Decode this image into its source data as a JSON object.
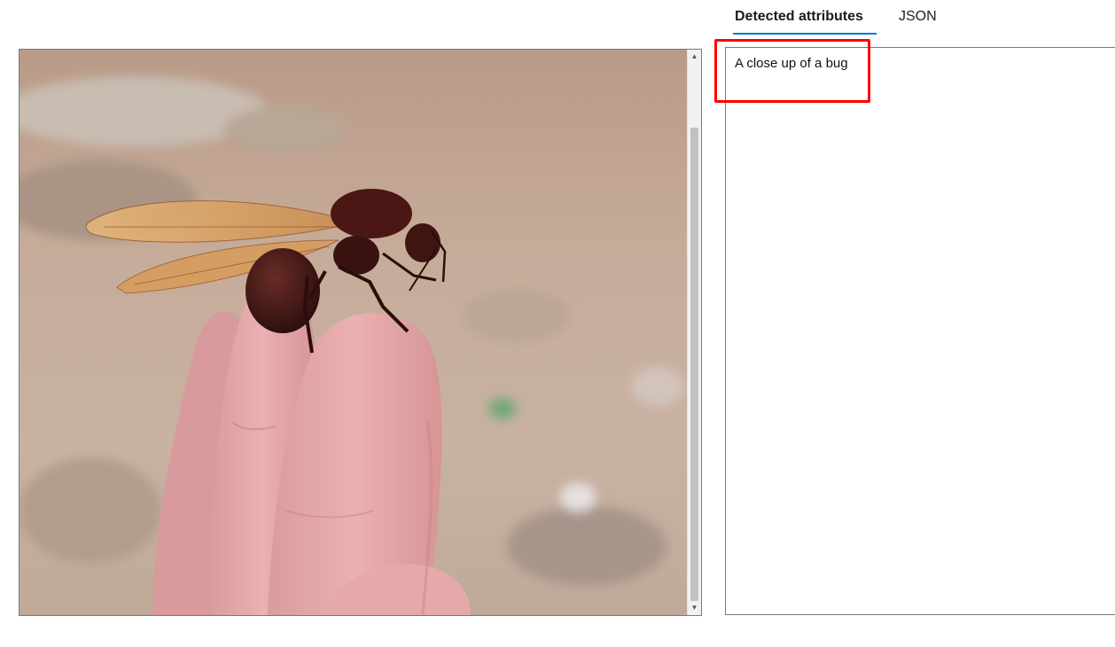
{
  "tabs": [
    {
      "label": "Detected attributes",
      "active": true
    },
    {
      "label": "JSON",
      "active": false
    }
  ],
  "results": {
    "caption": "A close up of a bug"
  },
  "colors": {
    "accent": "#0078d4",
    "highlight": "#ff0000"
  },
  "scrollbar": {
    "up_icon": "▲",
    "down_icon": "▼"
  },
  "icons": [
    "scroll-up-arrow-icon",
    "scroll-down-arrow-icon"
  ]
}
